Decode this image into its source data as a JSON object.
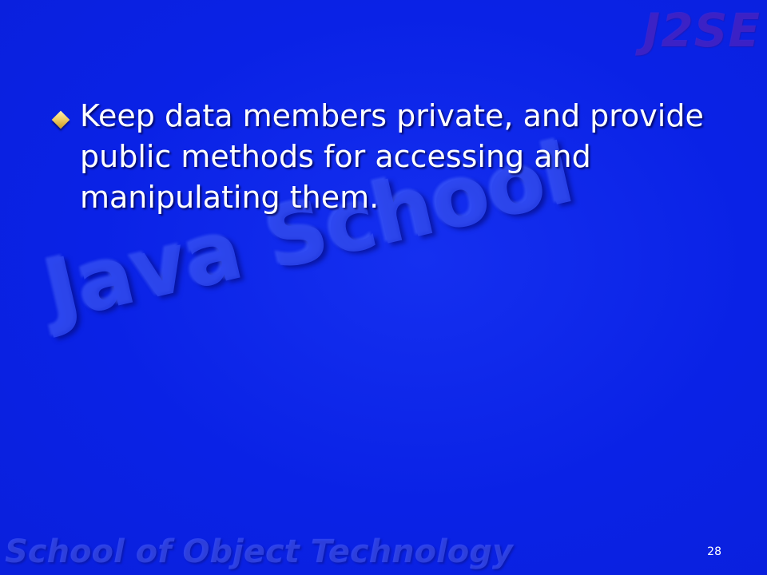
{
  "watermarks": {
    "top_right": "J2SE",
    "center": "Java School",
    "bottom": "School of Object Technology"
  },
  "content": {
    "bullets": [
      {
        "text": "Keep data members private, and provide public methods for accessing and manipulating them."
      }
    ]
  },
  "slide_number": "28",
  "colors": {
    "background": "#0a22e6",
    "text": "#ffffff",
    "bullet": "#f0cc60"
  },
  "icons": {
    "bullet": "diamond-bullet-icon"
  }
}
